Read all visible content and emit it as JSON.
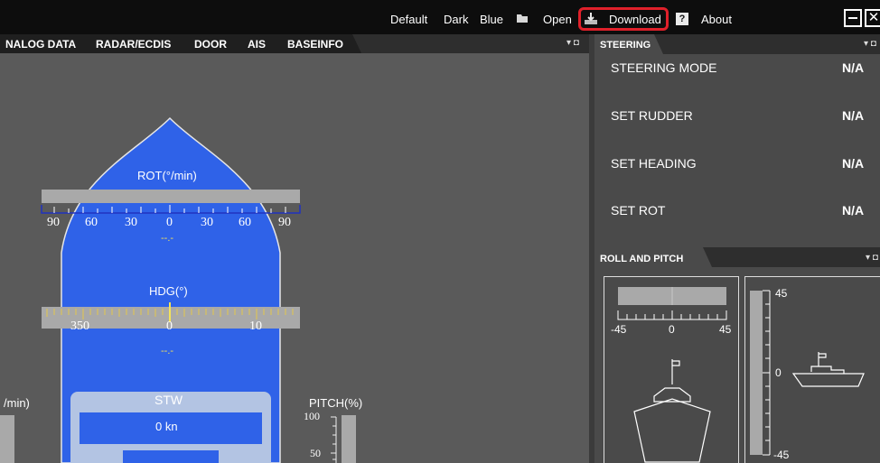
{
  "menu": {
    "default": "Default",
    "dark": "Dark",
    "blue": "Blue",
    "open": "Open",
    "download": "Download",
    "about": "About",
    "highlight_color": "#e0202a"
  },
  "tabs": [
    "NALOG DATA",
    "RADAR/ECDIS",
    "DOOR",
    "AIS",
    "BASEINFO"
  ],
  "ship": {
    "rot_label": "ROT(°/min)",
    "rot_ticks": [
      "90",
      "60",
      "30",
      "0",
      "30",
      "60",
      "90"
    ],
    "rot_value": "--.-",
    "hdg_label": "HDG(°)",
    "hdg_ticks": [
      "350",
      "0",
      "10"
    ],
    "hdg_value": "--.-",
    "stw_label": "STW",
    "stw_value": "0 kn",
    "left_edge_label": "/min)",
    "pitch_label": "PITCH(%)",
    "pitch_ticks": [
      "100",
      "50"
    ],
    "hull_color": "#2f62e8"
  },
  "steering": {
    "title": "STEERING",
    "rows": [
      {
        "label": "STEERING MODE",
        "value": "N/A"
      },
      {
        "label": "SET RUDDER",
        "value": "N/A"
      },
      {
        "label": "SET HEADING",
        "value": "N/A"
      },
      {
        "label": "SET ROT",
        "value": "N/A"
      }
    ]
  },
  "roll_pitch": {
    "title": "ROLL AND PITCH",
    "roll_ticks": [
      "-45",
      "0",
      "45"
    ],
    "pitch_ticks": [
      "45",
      "0",
      "-45"
    ]
  }
}
